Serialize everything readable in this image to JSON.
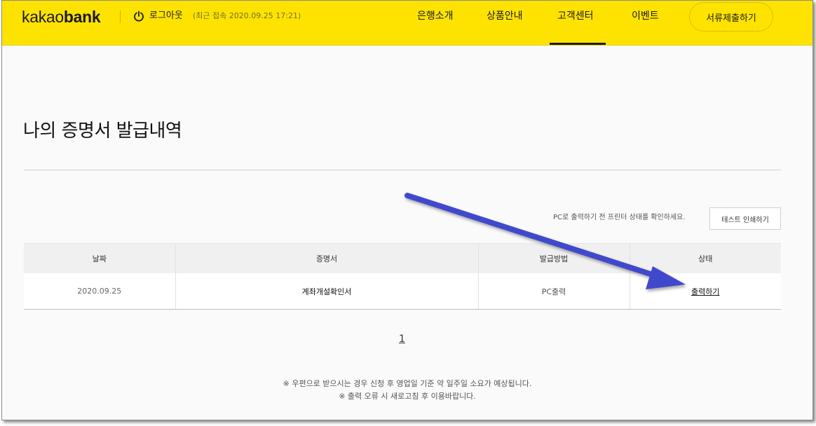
{
  "header": {
    "logo_light": "kakao",
    "logo_bold": "bank",
    "logout_label": "로그아웃",
    "last_login": "(최근 접속 2020.09.25 17:21)",
    "nav": [
      "은행소개",
      "상품안내",
      "고객센터",
      "이벤트"
    ],
    "active_nav": "고객센터",
    "submit_button": "서류제출하기"
  },
  "main": {
    "title": "나의 증명서 발급내역",
    "print_note": "PC로 출력하기 전 프린터 상태를 확인하세요.",
    "test_print_button": "테스트 인쇄하기",
    "table": {
      "headers": [
        "날짜",
        "증명서",
        "발급방법",
        "상태"
      ],
      "rows": [
        {
          "date": "2020.09.25",
          "certificate": "계좌개설확인서",
          "method": "PC출력",
          "status": "출력하기"
        }
      ]
    },
    "pagination": {
      "current_page": "1"
    },
    "notes": [
      "※ 우편으로 받으시는 경우 신청 후 영업일 기준 약 일주일 소요가 예상됩니다.",
      "※ 출력 오류 시 새로고침 후 이용바랍니다."
    ]
  },
  "colors": {
    "header_bg": "#ffe300",
    "annotation_arrow": "#3f48cc"
  },
  "icons": {
    "logout": "power-icon",
    "annotation": "arrow-annotation-icon"
  }
}
